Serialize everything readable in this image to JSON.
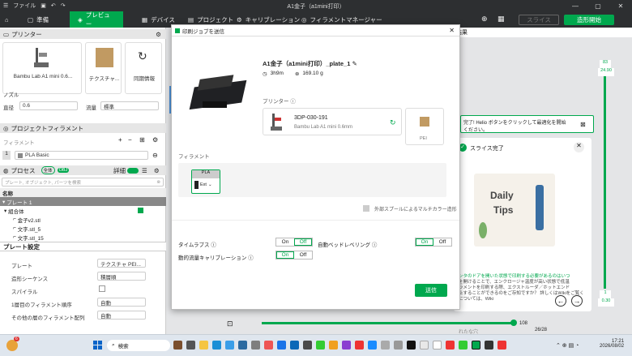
{
  "window": {
    "title": "A1金子（a1mini打印）",
    "menu_file": "ファイル"
  },
  "nav": {
    "tabs": [
      "準備",
      "プレビュー",
      "デバイス",
      "プロジェクト",
      "キャリブレーション",
      "フィラメントマネージャー"
    ],
    "slice": "スライス",
    "print": "造形開始"
  },
  "left": {
    "printer_section": "プリンター",
    "printer_name": "Bambu Lab A1 mini 0.6...",
    "plate_name": "テクスチャ...",
    "sync_label": "同期情報",
    "nozzle_label": "ノズル",
    "diameter_label": "直径",
    "diameter_value": "0.6",
    "flow_label": "流量",
    "flow_value": "標準",
    "project_filament": "プロジェクトフィラメント",
    "filament_label": "フィラメント",
    "filament_index": "1",
    "filament_name": "PLA Basic",
    "process_label": "プロセス",
    "global_label": "全体",
    "obj_label": "OBJ",
    "detail_label": "詳細",
    "search_placeholder": "プレート, オブジェクト, パーツを検索",
    "name_header": "名称",
    "plate": "プレート 1",
    "group": "組合体",
    "items": [
      "金子v2.stl",
      "文字.stl_5",
      "文字.stl_15"
    ],
    "plate_settings": "プレート設定",
    "settings": [
      {
        "label": "プレート",
        "value": "テクスチャ PEI..."
      },
      {
        "label": "造形シーケンス",
        "value": "積層順"
      },
      {
        "label": "スパイラル",
        "value": ""
      },
      {
        "label": "1層目のフィラメント順序",
        "value": "自動"
      },
      {
        "label": "その他の層のフィラメント配列",
        "value": "自動"
      }
    ]
  },
  "modal": {
    "title": "印刷ジョブを送信",
    "job_name": "A1金子（a1mini打印）_plate_1",
    "time": "3h9m",
    "weight": "169.10 g",
    "printer_label": "プリンター",
    "printer_id": "3DP-030-191",
    "printer_model": "Bambu Lab A1 mini  0.6mm",
    "pei_label": "PEI",
    "filament_label": "フィラメント",
    "fil_type": "PLA",
    "fil_slot": "Ext",
    "multicolor": "外部スプールによるマルチカラー造形",
    "timelapse": "タイムラプス",
    "auto_leveling": "自動ベッドレベリング",
    "flow_calib": "動的流量キャリブレーション",
    "on": "On",
    "off": "Off",
    "send": "送信"
  },
  "right": {
    "result_label": "結果",
    "notice": "完了! Helio ボタンをクリックして最適化を開始",
    "notice2": "ください。",
    "slice_done": "スライス完了",
    "tips1": "Daily",
    "tips2": "Tips",
    "tip_text": [
      "ンタのドアを開いた状態で印刷する必要があるのはいつ",
      "を開けることで、エンクロージャ温度が高い状態で低温",
      "ラメントを印刷する際、エクストルーダ／ホットエンド",
      "止することができるのをご存知ですか？ 詳しくはWikiをご覧く",
      "については、Wiki"
    ],
    "dismiss": "れたな穴",
    "page": "26/28",
    "layer_top": "83",
    "layer_top_h": "24.90",
    "layer_bottom": "1",
    "layer_bottom_h": "0.30",
    "progress": "108"
  },
  "taskbar": {
    "search": "検索",
    "weather_temp": "6",
    "time": "17:21",
    "date": "2026/08/02"
  }
}
